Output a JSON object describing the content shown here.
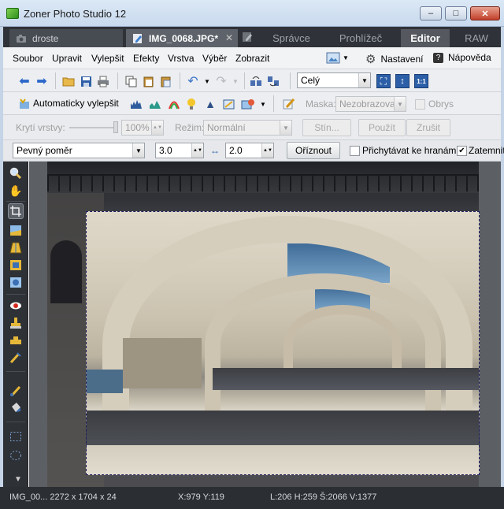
{
  "window": {
    "title": "Zoner Photo Studio 12",
    "min_glyph": "–",
    "max_glyph": "□",
    "close_glyph": "✕"
  },
  "tabs": {
    "documents": [
      {
        "label": "droste",
        "icon": "camera-icon"
      },
      {
        "label": "IMG_0068.JPG*",
        "icon": "edit-icon",
        "close": "✕"
      }
    ],
    "modes": [
      {
        "label": "Správce"
      },
      {
        "label": "Prohlížeč"
      },
      {
        "label": "Editor",
        "active": true
      },
      {
        "label": "RAW"
      }
    ]
  },
  "menu": {
    "items": [
      "Soubor",
      "Upravit",
      "Vylepšit",
      "Efekty",
      "Vrstva",
      "Výběr",
      "Zobrazit"
    ],
    "settings": "Nastavení",
    "help": "Nápověda"
  },
  "toolbar1": {
    "zoom_select": "Celý",
    "zoom_icons": [
      "fit-window-icon",
      "fit-height-icon",
      "actual-size-icon"
    ],
    "actual_size_glyph": "1:1"
  },
  "toolbar2": {
    "auto_enhance": "Automaticky vylepšit",
    "mask_label": "Maska:",
    "mask_select": "Nezobrazovat",
    "outline_label": "Obrys"
  },
  "toolbar3": {
    "opacity_label": "Krytí vrstvy:",
    "opacity_value": "100%",
    "mode_label": "Režim:",
    "mode_select": "Normální",
    "shadow_button": "Stín...",
    "apply_button": "Použít",
    "cancel_button": "Zrušit"
  },
  "toolbar4": {
    "ratio_select": "Pevný poměr",
    "width_value": "3.0",
    "height_value": "2.0",
    "crop_button": "Oříznout",
    "snap_label": "Přichytávat ke hranám",
    "darken_label": "Zatemnit",
    "snap_checked": false,
    "darken_checked": true
  },
  "status": {
    "file": "IMG_00... 2272 x 1704 x 24",
    "cursor": "X:979  Y:119",
    "selection": "L:206  H:259  Š:2066  V:1377"
  },
  "colors": {
    "dark_panel": "#2e3136",
    "canvas_bg": "#5c5f64",
    "active_mode_tab": "#55595f"
  }
}
